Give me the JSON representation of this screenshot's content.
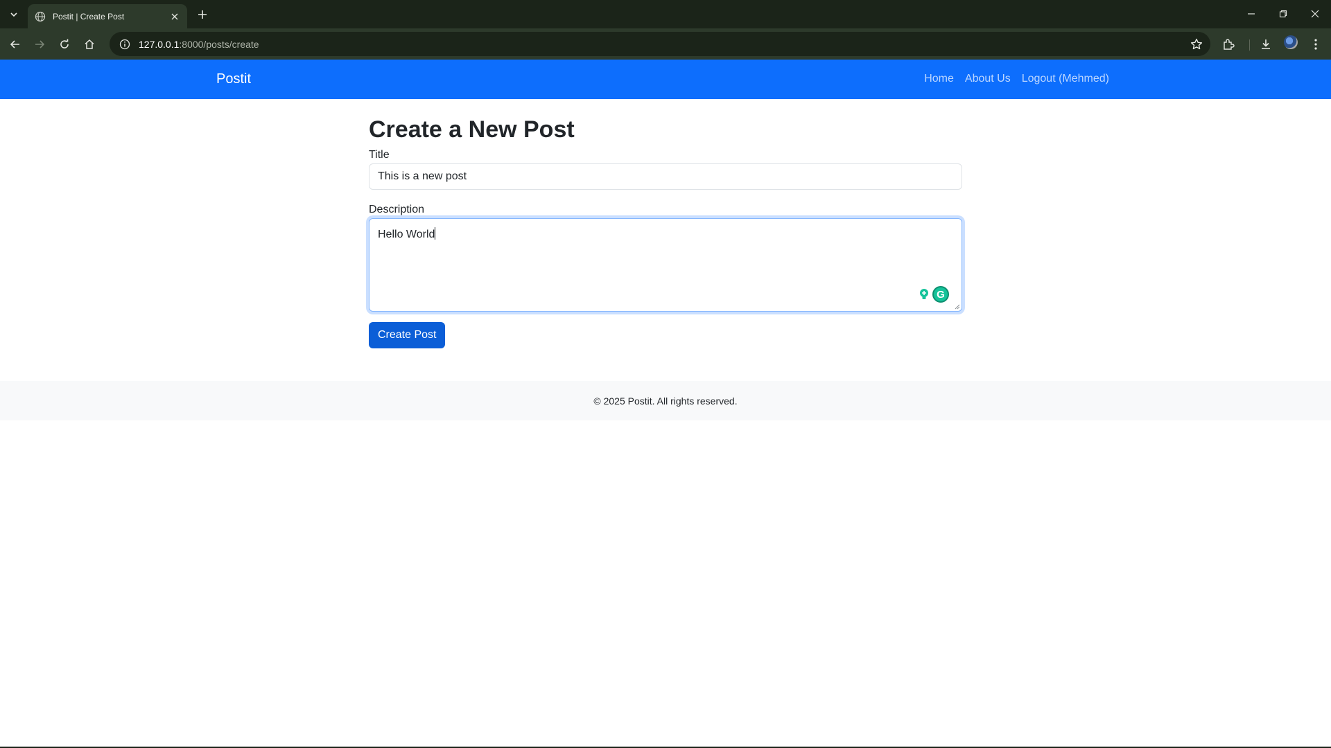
{
  "browser": {
    "tab_title": "Postit | Create Post",
    "url_host": "127.0.0.1",
    "url_path": ":8000/posts/create"
  },
  "navbar": {
    "brand": "Postit",
    "links": [
      "Home",
      "About Us",
      "Logout (Mehmed)"
    ],
    "background_color": "#0d6efd"
  },
  "form": {
    "heading": "Create a New Post",
    "title_label": "Title",
    "title_value": "This is a new post",
    "description_label": "Description",
    "description_value": "Hello World",
    "submit_label": "Create Post",
    "grammarly_letter": "G"
  },
  "footer": {
    "text": "© 2025 Postit. All rights reserved."
  },
  "icons": [
    "tab-search-icon",
    "globe-icon",
    "close-icon",
    "plus-icon",
    "minimize-icon",
    "restore-icon",
    "window-close-icon",
    "back-arrow-icon",
    "forward-arrow-icon",
    "reload-icon",
    "home-icon",
    "site-info-icon",
    "star-icon",
    "extensions-icon",
    "download-icon",
    "menu-dots-icon",
    "grammarly-bulb-icon",
    "grammarly-icon"
  ]
}
